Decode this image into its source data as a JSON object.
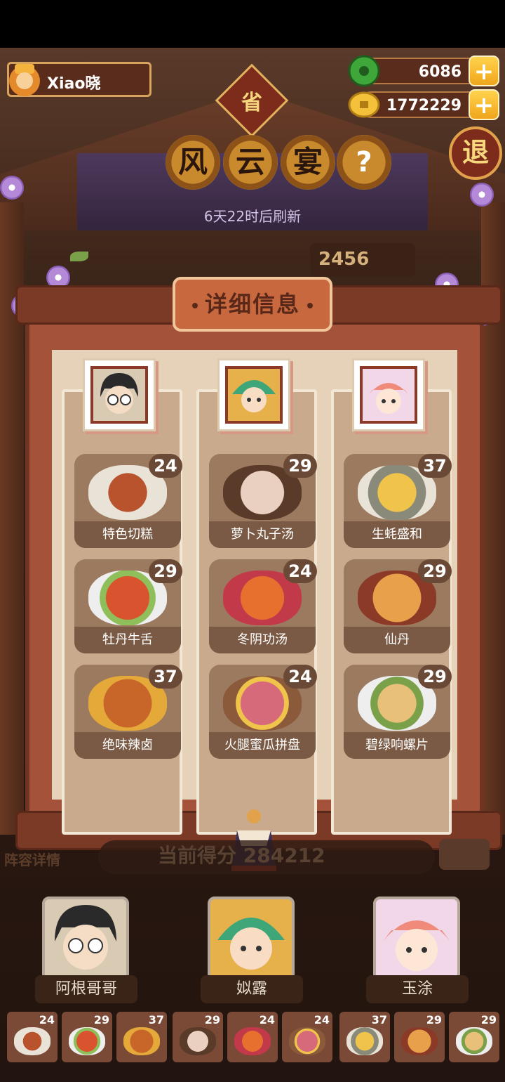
{
  "player": {
    "name": "Xiao晓"
  },
  "currencies": {
    "jade": "6086",
    "coins": "1772229"
  },
  "province_badge": "省",
  "exit_label": "退",
  "event_title": [
    "风",
    "云",
    "宴"
  ],
  "help_label": "?",
  "refresh_text": "6天22时后刷新",
  "score_peek": "2456",
  "panel": {
    "title": "详细信息",
    "columns": [
      {
        "dishes": [
          {
            "name": "特色切糕",
            "level": "24"
          },
          {
            "name": "牡丹牛舌",
            "level": "29"
          },
          {
            "name": "绝味辣卤",
            "level": "37"
          }
        ]
      },
      {
        "dishes": [
          {
            "name": "萝卜丸子汤",
            "level": "29"
          },
          {
            "name": "冬阴功汤",
            "level": "24"
          },
          {
            "name": "火腿蜜瓜拼盘",
            "level": "24"
          }
        ]
      },
      {
        "dishes": [
          {
            "name": "生蚝盛和",
            "level": "37"
          },
          {
            "name": "仙丹",
            "level": "29"
          },
          {
            "name": "碧绿响螺片",
            "level": "29"
          }
        ]
      }
    ]
  },
  "team": {
    "lineup_label": "阵容详情",
    "score_text": "当前得分 284212",
    "members": [
      {
        "name": "阿根哥哥"
      },
      {
        "name": "姒露"
      },
      {
        "name": "玉涂"
      }
    ],
    "slot_levels": [
      "24",
      "29",
      "37",
      "29",
      "24",
      "24",
      "37",
      "29",
      "29"
    ]
  },
  "colors": {
    "accent": "#c7683f",
    "gold": "#f0a51b",
    "board": "#a5523a"
  }
}
